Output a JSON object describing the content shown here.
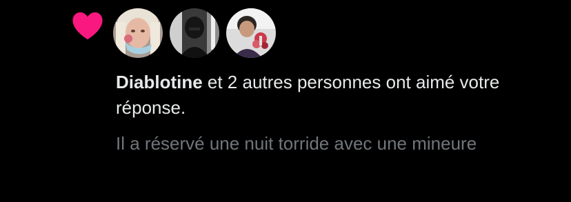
{
  "notification": {
    "icon": "heart-icon",
    "icon_color": "#f91880",
    "avatars": [
      {
        "name": "avatar-1"
      },
      {
        "name": "avatar-2"
      },
      {
        "name": "avatar-3"
      }
    ],
    "liker_name": "Diablotine",
    "message_rest": " et 2 autres personnes ont aimé votre réponse.",
    "reply_text": "Il a réservé une nuit torride avec une mineure"
  },
  "colors": {
    "background": "#000000",
    "primary_text": "#e7e9ea",
    "secondary_text": "#71767b",
    "like": "#f91880"
  }
}
